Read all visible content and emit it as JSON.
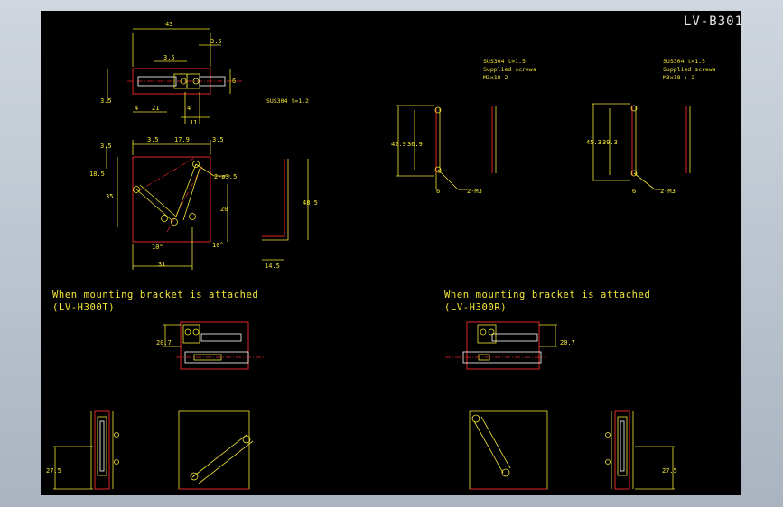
{
  "drawing": {
    "title": "LV-B301",
    "material_main": "SUS304   t=1.2",
    "bracket_left": {
      "material": "SUS304   t=1.5",
      "screws_label": "Supplied screws",
      "screws_value": "M3x18   2",
      "dim_outer": "42.9",
      "dim_inner": "36.9",
      "dim_small": "6",
      "callout": "2-M3"
    },
    "bracket_right": {
      "material": "SUS304   t=1.5",
      "screws_label": "Supplied screws",
      "screws_value": "M3x18 : 2",
      "dim_outer": "45.3",
      "dim_inner": "39.3",
      "dim_small": "6",
      "callout": "2-M3"
    },
    "top_view_dims": {
      "width": "43",
      "right_gap": "3.5",
      "slot": "3.5",
      "height_right": "6",
      "height_left": "3.5",
      "bottom_left": "4",
      "bottom_mid": "21",
      "bottom_small": "4",
      "bottom_right": "11"
    },
    "front_view_dims": {
      "top_a": "3.5",
      "top_b": "17.9",
      "top_c": "3.5",
      "left_a": "3.5",
      "left_b": "18.5",
      "left_c": "35",
      "right_h": "20",
      "hole_callout": "2-ø3.5",
      "angle_left": "10°",
      "angle_right": "10°",
      "bottom": "31"
    },
    "side_view_dims": {
      "height": "48.5",
      "base": "14.5"
    },
    "caption_left": {
      "line1": "When mounting bracket is attached",
      "line2": "(LV-H300T)",
      "dim_top": "20.7",
      "dim_side": "27.5"
    },
    "caption_right": {
      "line1": "When mounting bracket is attached",
      "line2": "(LV-H300R)",
      "dim_top": "20.7",
      "dim_side": "27.5"
    }
  }
}
